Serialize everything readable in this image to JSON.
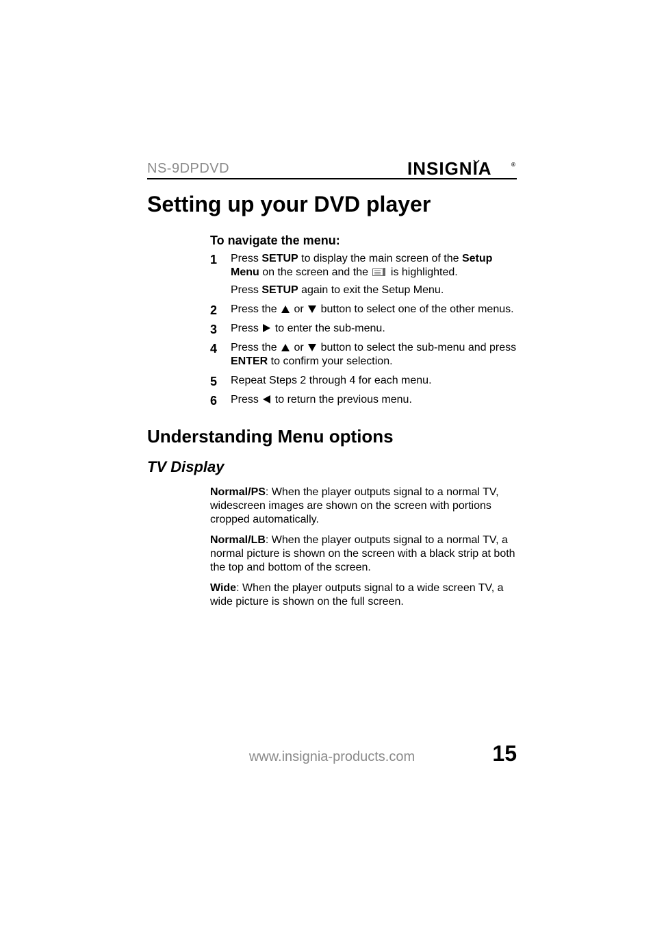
{
  "header": {
    "model": "NS-9DPDVD",
    "brand": "INSIGNIA"
  },
  "title": "Setting up your DVD player",
  "nav_heading": "To navigate the menu:",
  "steps": {
    "s1": {
      "num": "1",
      "a1": "Press ",
      "a2": "SETUP",
      "a3": " to display the main screen of the ",
      "a4": "Setup Menu",
      "a5": " on the screen and the ",
      "a6": " is highlighted.",
      "b1": "Press ",
      "b2": "SETUP",
      "b3": " again to exit the Setup Menu."
    },
    "s2": {
      "num": "2",
      "a1": "Press the ",
      "a2": " or ",
      "a3": " button to select one of the other menus."
    },
    "s3": {
      "num": "3",
      "a1": "Press ",
      "a2": " to enter the sub-menu."
    },
    "s4": {
      "num": "4",
      "a1": "Press the ",
      "a2": " or ",
      "a3": " button to select the sub-menu and press ",
      "a4": "ENTER",
      "a5": " to confirm your selection."
    },
    "s5": {
      "num": "5",
      "a1": "Repeat Steps 2 through 4 for each menu."
    },
    "s6": {
      "num": "6",
      "a1": "Press ",
      "a2": " to return the previous menu."
    }
  },
  "section2": "Understanding Menu options",
  "subsection": "TV Display",
  "tv": {
    "p1a": "Normal/PS",
    "p1b": ": When the player outputs signal to a normal TV, widescreen images are shown on the screen with portions cropped automatically.",
    "p2a": "Normal/LB",
    "p2b": ": When the player outputs signal to a normal TV, a normal picture is shown on the screen with a black strip at both the top and bottom of the screen.",
    "p3a": "Wide",
    "p3b": ": When the player outputs signal to a wide screen TV, a wide picture is shown on the full screen."
  },
  "footer": {
    "url": "www.insignia-products.com",
    "page": "15"
  }
}
